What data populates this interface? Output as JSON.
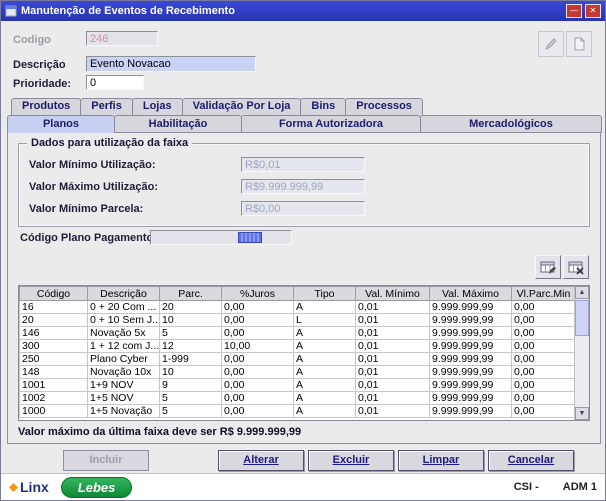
{
  "window": {
    "title": "Manutenção de Eventos de Recebimento"
  },
  "icons": {
    "minimize": "—",
    "close": "✕",
    "scroll_up": "▲",
    "scroll_down": "▼"
  },
  "form": {
    "codigo": {
      "label": "Codigo",
      "value": "246"
    },
    "descricao": {
      "label": "Descrição",
      "value": "Evento Novacao"
    },
    "prioridade": {
      "label": "Prioridade:",
      "value": "0"
    }
  },
  "tabs_row1": {
    "produtos": "Produtos",
    "perfis": "Perfis",
    "lojas": "Lojas",
    "validacao": "Validação Por Loja",
    "bins": "Bins",
    "processos": "Processos"
  },
  "tabs_row2": {
    "planos": "Planos",
    "habilitacao": "Habilitação",
    "forma": "Forma Autorizadora",
    "mercadologicos": "Mercadológicos"
  },
  "faixa": {
    "title": "Dados para utilização da faixa",
    "min_utilizacao": {
      "label": "Valor Mínimo Utilização:",
      "value": "R$0,01"
    },
    "max_utilizacao": {
      "label": "Valor Máximo Utilização:",
      "value": "R$9.999.999,99"
    },
    "min_parcela": {
      "label": "Valor Mínimo Parcela:",
      "value": "R$0,00"
    }
  },
  "plano_pagamento": {
    "label": "Código Plano Pagamento"
  },
  "table": {
    "columns": [
      "Código",
      "Descrição",
      "Parc.",
      "%Juros",
      "Tipo",
      "Val. Mínimo",
      "Val. Máximo",
      "Vl.Parc.Min"
    ],
    "rows": [
      [
        "16",
        "0 + 20 Com ...",
        "20",
        "0,00",
        "A",
        "0,01",
        "9.999.999,99",
        "0,00"
      ],
      [
        "20",
        "0 + 10 Sem J...",
        "10",
        "0,00",
        "L",
        "0,01",
        "9.999.999,99",
        "0,00"
      ],
      [
        "146",
        "Novação 5x",
        "5",
        "0,00",
        "A",
        "0,01",
        "9.999.999,99",
        "0,00"
      ],
      [
        "300",
        "1 + 12 com J...",
        "12",
        "10,00",
        "A",
        "0,01",
        "9.999.999,99",
        "0,00"
      ],
      [
        "250",
        "Plano Cyber",
        "1-999",
        "0,00",
        "A",
        "0,01",
        "9.999.999,99",
        "0,00"
      ],
      [
        "148",
        "Novação 10x",
        "10",
        "0,00",
        "A",
        "0,01",
        "9.999.999,99",
        "0,00"
      ],
      [
        "1001",
        "1+9 NOV",
        "9",
        "0,00",
        "A",
        "0,01",
        "9.999.999,99",
        "0,00"
      ],
      [
        "1002",
        "1+5 NOV",
        "5",
        "0,00",
        "A",
        "0,01",
        "9.999.999,99",
        "0,00"
      ],
      [
        "1000",
        "1+5 Novação",
        "5",
        "0,00",
        "A",
        "0,01",
        "9.999.999,99",
        "0,00"
      ]
    ]
  },
  "footer_note": "Valor máximo da última faixa deve ser R$ 9.999.999,99",
  "buttons": {
    "incluir": "Incluir",
    "alterar": "Alterar",
    "excluir": "Excluir",
    "limpar": "Limpar",
    "cancelar": "Cancelar"
  },
  "statusbar": {
    "linx": "Linx",
    "lebes": "Lebes",
    "csi": "CSI -",
    "adm": "ADM 1"
  },
  "colors": {
    "titlebar": "#2f3fc5",
    "selected_tab": "#c7d0f0",
    "close_button": "#c23a31",
    "lebes_green": "#1f9d44"
  }
}
